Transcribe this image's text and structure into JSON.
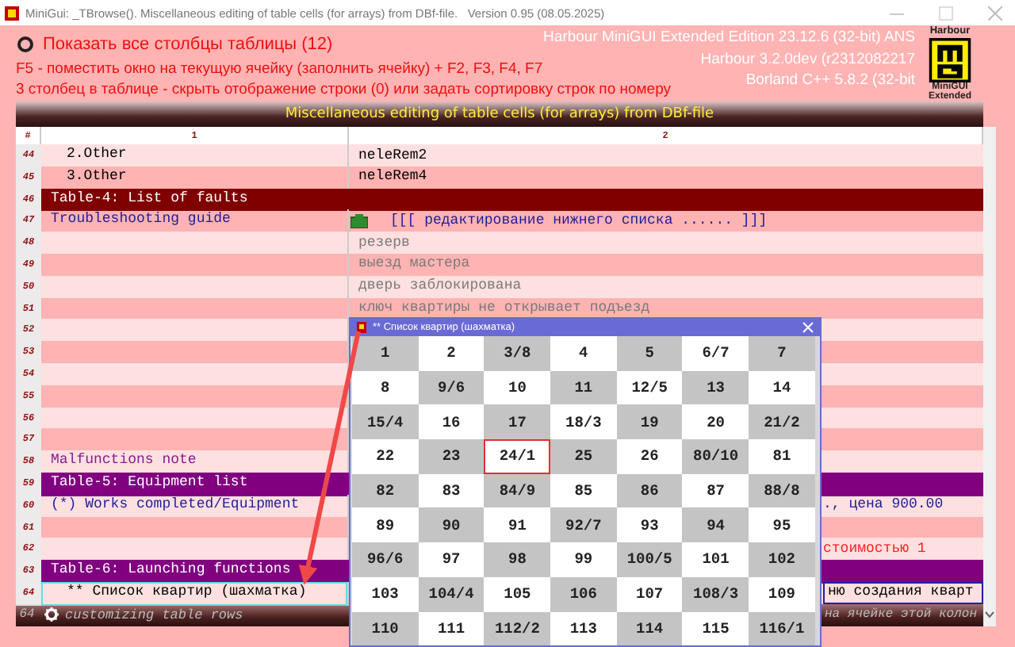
{
  "window": {
    "title": "MiniGui: _TBrowse(). Miscellaneous editing of table cells (for arrays) from DBf-file.   Version 0.95 (08.05.2025)"
  },
  "header": {
    "option": {
      "label": "Показать все столбцы таблицы (12)",
      "checked": false
    },
    "hints": [
      "F5 - поместить окно на текущую ячейку (заполнить ячейку) + F2, F3, F4, F7",
      "3 столбец в таблице - скрыть отображение строки (0) или задать сортировку строк по номеру"
    ],
    "build_info": [
      "Harbour MiniGUI Extended Edition 23.12.6 (32-bit) ANS",
      "Harbour 3.2.0dev (r2312082217",
      "Borland C++ 5.8.2 (32-bit"
    ],
    "logo": {
      "top": "Harbour",
      "bottom": [
        "MiniGUI",
        "Extended"
      ]
    }
  },
  "table": {
    "title": "Miscellaneous editing of table cells (for arrays) from DBf-file",
    "columns": [
      "#",
      "1",
      "2"
    ],
    "rows": [
      {
        "number": "44",
        "selected": false,
        "column_1": {
          "text": "2.Other",
          "kind": "sub"
        },
        "column_2": {
          "text": "neleRem2",
          "color": "#000000"
        }
      },
      {
        "number": "45",
        "selected": false,
        "column_1": {
          "text": "3.Other",
          "kind": "sub"
        },
        "column_2": {
          "text": "neleRem4",
          "color": "#000000"
        }
      },
      {
        "number": "46",
        "selected": false,
        "kind": "band",
        "color": "#800000",
        "column_1": {
          "text": "Table-4: List of faults"
        }
      },
      {
        "number": "47",
        "selected": false,
        "column_1": {
          "text": "Troubleshooting guide",
          "color": "#1c1c9a"
        },
        "column_2": {
          "text": "[[[ редактирование нижнего списка ...... ]]]",
          "color": "#1c1c9a",
          "icon": true
        }
      },
      {
        "number": "48",
        "selected": false,
        "column_2": {
          "text": "резерв",
          "color": "#7a7a7a"
        }
      },
      {
        "number": "49",
        "selected": false,
        "column_2": {
          "text": "выезд мастера",
          "color": "#7a7a7a"
        }
      },
      {
        "number": "50",
        "selected": false,
        "column_2": {
          "text": "дверь заблокирована",
          "color": "#7a7a7a"
        }
      },
      {
        "number": "51",
        "selected": false,
        "column_2": {
          "text": "ключ квартиры не открывает подъезд",
          "color": "#7a7a7a"
        }
      },
      {
        "number": "52",
        "selected": false
      },
      {
        "number": "53",
        "selected": false
      },
      {
        "number": "54",
        "selected": false
      },
      {
        "number": "55",
        "selected": false
      },
      {
        "number": "56",
        "selected": false
      },
      {
        "number": "57",
        "selected": false
      },
      {
        "number": "58",
        "selected": false,
        "column_1": {
          "text": "Malfunctions note",
          "color": "#8b1a8b"
        }
      },
      {
        "number": "59",
        "selected": false,
        "kind": "band",
        "color": "#800080",
        "column_1": {
          "text": "Table-5: Equipment list"
        }
      },
      {
        "number": "60",
        "selected": false,
        "column_1": {
          "text": "(*) Works completed/Equipment",
          "color": "#1c1c9a"
        },
        "column_2": {
          "text": "., цена 900.00",
          "color": "#1c1c9a",
          "kind": "tail"
        }
      },
      {
        "number": "61",
        "selected": false
      },
      {
        "number": "62",
        "selected": false,
        "column_2": {
          "text": "стоимостью 1",
          "color": "#ff2020",
          "kind": "tail"
        }
      },
      {
        "number": "63",
        "selected": false,
        "kind": "band",
        "color": "#800080",
        "column_1": {
          "text": "Table-6: Launching functions"
        }
      },
      {
        "number": "64",
        "selected": true,
        "column_1": {
          "text": "** Список квартир (шахматка)",
          "kind": "sub"
        },
        "column_2": {
          "text": "ню создания кварт",
          "color": "#000000",
          "kind": "tail"
        }
      }
    ],
    "footer": {
      "row_number": "64",
      "text": "customizing table rows",
      "right_text": "на ячейке этой колон"
    }
  },
  "popup": {
    "title": "** Список квартир (шахматка)",
    "cells": [
      [
        {
          "label": "1",
          "selected": false
        },
        {
          "label": "2",
          "selected": false
        },
        {
          "label": "3/8",
          "selected": false
        },
        {
          "label": "4",
          "selected": false
        },
        {
          "label": "5",
          "selected": false
        },
        {
          "label": "6/7",
          "selected": false
        },
        {
          "label": "7",
          "selected": false
        }
      ],
      [
        {
          "label": "8",
          "selected": false
        },
        {
          "label": "9/6",
          "selected": false
        },
        {
          "label": "10",
          "selected": false
        },
        {
          "label": "11",
          "selected": false
        },
        {
          "label": "12/5",
          "selected": false
        },
        {
          "label": "13",
          "selected": false
        },
        {
          "label": "14",
          "selected": false
        }
      ],
      [
        {
          "label": "15/4",
          "selected": false
        },
        {
          "label": "16",
          "selected": false
        },
        {
          "label": "17",
          "selected": false
        },
        {
          "label": "18/3",
          "selected": false
        },
        {
          "label": "19",
          "selected": false
        },
        {
          "label": "20",
          "selected": false
        },
        {
          "label": "21/2",
          "selected": false
        }
      ],
      [
        {
          "label": "22",
          "selected": false
        },
        {
          "label": "23",
          "selected": false
        },
        {
          "label": "24/1",
          "selected": true
        },
        {
          "label": "25",
          "selected": false
        },
        {
          "label": "26",
          "selected": false
        },
        {
          "label": "80/10",
          "selected": false
        },
        {
          "label": "81",
          "selected": false
        }
      ],
      [
        {
          "label": "82",
          "selected": false
        },
        {
          "label": "83",
          "selected": false
        },
        {
          "label": "84/9",
          "selected": false
        },
        {
          "label": "85",
          "selected": false
        },
        {
          "label": "86",
          "selected": false
        },
        {
          "label": "87",
          "selected": false
        },
        {
          "label": "88/8",
          "selected": false
        }
      ],
      [
        {
          "label": "89",
          "selected": false
        },
        {
          "label": "90",
          "selected": false
        },
        {
          "label": "91",
          "selected": false
        },
        {
          "label": "92/7",
          "selected": false
        },
        {
          "label": "93",
          "selected": false
        },
        {
          "label": "94",
          "selected": false
        },
        {
          "label": "95",
          "selected": false
        }
      ],
      [
        {
          "label": "96/6",
          "selected": false
        },
        {
          "label": "97",
          "selected": false
        },
        {
          "label": "98",
          "selected": false
        },
        {
          "label": "99",
          "selected": false
        },
        {
          "label": "100/5",
          "selected": false
        },
        {
          "label": "101",
          "selected": false
        },
        {
          "label": "102",
          "selected": false
        }
      ],
      [
        {
          "label": "103",
          "selected": false
        },
        {
          "label": "104/4",
          "selected": false
        },
        {
          "label": "105",
          "selected": false
        },
        {
          "label": "106",
          "selected": false
        },
        {
          "label": "107",
          "selected": false
        },
        {
          "label": "108/3",
          "selected": false
        },
        {
          "label": "109",
          "selected": false
        }
      ],
      [
        {
          "label": "110",
          "selected": false
        },
        {
          "label": "111",
          "selected": false
        },
        {
          "label": "112/2",
          "selected": false
        },
        {
          "label": "113",
          "selected": false
        },
        {
          "label": "114",
          "selected": false
        },
        {
          "label": "115",
          "selected": false
        },
        {
          "label": "116/1",
          "selected": false
        }
      ]
    ]
  }
}
